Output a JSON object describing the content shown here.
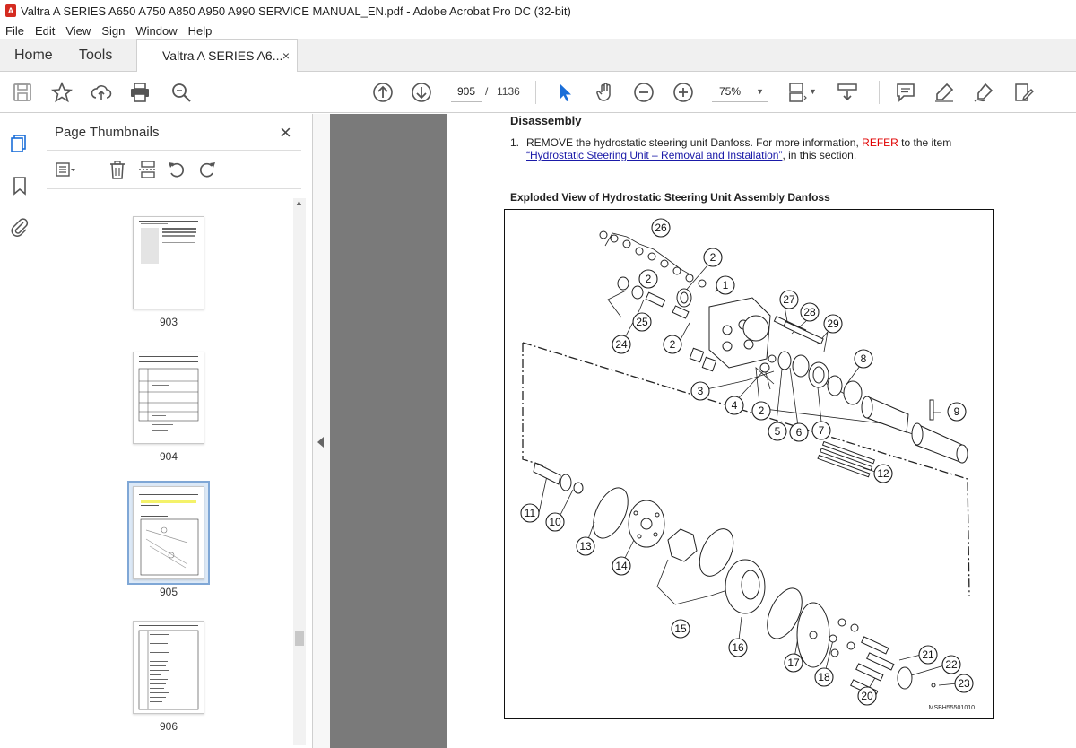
{
  "window": {
    "title": "Valtra A SERIES A650 A750 A850 A950 A990 SERVICE MANUAL_EN.pdf - Adobe Acrobat Pro DC (32-bit)"
  },
  "menu": [
    "File",
    "Edit",
    "View",
    "Sign",
    "Window",
    "Help"
  ],
  "tabs": {
    "home": "Home",
    "tools": "Tools",
    "document": "Valtra A SERIES A6...",
    "close": "×"
  },
  "toolbar": {
    "current_page": "905",
    "separator": "/",
    "total_pages": "1136",
    "zoom": "75%"
  },
  "left_rail": {
    "icons": [
      "pages-icon",
      "bookmark-icon",
      "attachment-icon"
    ]
  },
  "thumbnail_panel": {
    "title": "Page Thumbnails",
    "close": "×",
    "pages": [
      {
        "label": "903",
        "selected": false
      },
      {
        "label": "904",
        "selected": false
      },
      {
        "label": "905",
        "selected": true
      },
      {
        "label": "906",
        "selected": false
      }
    ]
  },
  "document": {
    "heading": "Disassembly",
    "step_number": "1.",
    "step_text_before": "REMOVE the hydrostatic steering unit Danfoss. For more information, ",
    "step_refer": "REFER",
    "step_text_after_refer": " to the item",
    "step_link": "“Hydrostatic Steering Unit – Removal and Installation”",
    "step_text_end": ", in this section.",
    "figure_title": "Exploded View of Hydrostatic Steering Unit Assembly Danfoss",
    "figure_code": "MSBH55501010",
    "callouts": [
      "26",
      "2",
      "1",
      "2",
      "27",
      "28",
      "29",
      "25",
      "24",
      "2",
      "8",
      "3",
      "4",
      "2",
      "9",
      "5",
      "6",
      "7",
      "12",
      "11",
      "10",
      "13",
      "14",
      "15",
      "16",
      "17",
      "18",
      "21",
      "22",
      "23",
      "20"
    ]
  },
  "colors": {
    "refer": "#e00000",
    "link": "#1a1aa8",
    "selected_thumb": "#7fa7d6"
  }
}
